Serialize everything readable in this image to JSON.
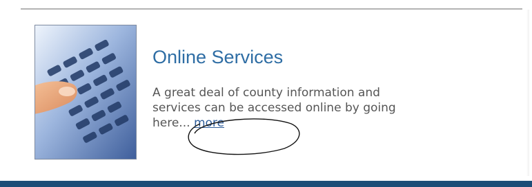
{
  "services_block": {
    "title": "Online Services",
    "description_lines": [
      "A great deal of county information and",
      "services can be accessed online by going",
      "here..."
    ],
    "more_link": "more",
    "thumbnail_icon": "keypad-phone-photo",
    "annotation": "hand-drawn-circle-around-more"
  },
  "colors": {
    "title": "#2e6da4",
    "link": "#2e5d9a",
    "body_text": "#555555",
    "bottom_bar": "#1d4e78",
    "rule": "#b3b3b3"
  }
}
